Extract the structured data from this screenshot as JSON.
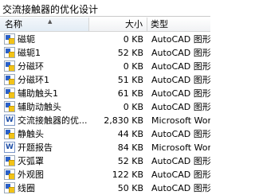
{
  "window": {
    "title": "交流接触器的优化设计"
  },
  "columns": {
    "name": "名称",
    "size": "大小",
    "type": "类型"
  },
  "files": [
    {
      "name": "磁轭",
      "size": "0 KB",
      "type": "AutoCAD 图形",
      "icon": "dwg-file-icon"
    },
    {
      "name": "磁轭1",
      "size": "52 KB",
      "type": "AutoCAD 图形",
      "icon": "dwg-file-icon"
    },
    {
      "name": "分磁环",
      "size": "0 KB",
      "type": "AutoCAD 图形",
      "icon": "dwg-file-icon"
    },
    {
      "name": "分磁环1",
      "size": "51 KB",
      "type": "AutoCAD 图形",
      "icon": "dwg-file-icon"
    },
    {
      "name": "辅助触头1",
      "size": "61 KB",
      "type": "AutoCAD 图形",
      "icon": "dwg-file-icon"
    },
    {
      "name": "辅助动触头",
      "size": "0 KB",
      "type": "AutoCAD 图形",
      "icon": "dwg-file-icon"
    },
    {
      "name": "交流接触器的优...",
      "size": "2,830 KB",
      "type": "Microsoft Word",
      "icon": "word-doc-icon"
    },
    {
      "name": "静触头",
      "size": "44 KB",
      "type": "AutoCAD 图形",
      "icon": "dwg-file-icon"
    },
    {
      "name": "开题报告",
      "size": "84 KB",
      "type": "Microsoft Word",
      "icon": "word-doc-icon"
    },
    {
      "name": "灭弧罩",
      "size": "52 KB",
      "type": "AutoCAD 图形",
      "icon": "dwg-file-icon"
    },
    {
      "name": "外观图",
      "size": "122 KB",
      "type": "AutoCAD 图形",
      "icon": "dwg-file-icon"
    },
    {
      "name": "线圈",
      "size": "50 KB",
      "type": "AutoCAD 图形",
      "icon": "dwg-file-icon"
    }
  ]
}
